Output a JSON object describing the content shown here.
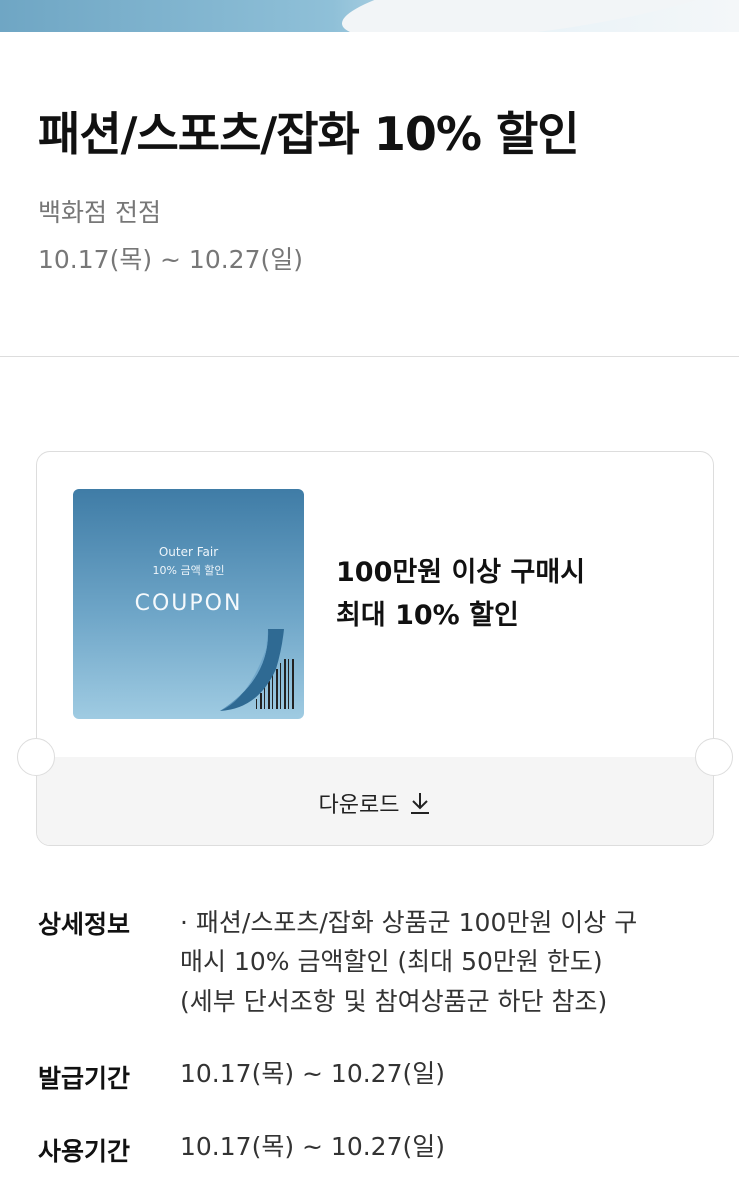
{
  "event": {
    "title": "패션/스포츠/잡화 10% 할인",
    "location": "백화점 전점",
    "period": "10.17(목) ~ 10.27(일)"
  },
  "coupon": {
    "image_text_1": "Outer Fair",
    "image_text_2": "10% 금액 할인",
    "image_text_3": "COUPON",
    "offer_line_1": "100만원 이상 구매시",
    "offer_line_2": "최대 10% 할인",
    "download_label": "다운로드",
    "download_icon": "download-arrow-icon"
  },
  "details": {
    "info_label": "상세정보",
    "info_line_1": "· 패션/스포츠/잡화 상품군 100만원 이상 구",
    "info_line_2": "매시 10% 금액할인 (최대 50만원 한도)",
    "info_line_3": "(세부 단서조항 및 참여상품군 하단 참조)",
    "issue_label": "발급기간",
    "issue_period": "10.17(목) ~ 10.27(일)",
    "use_label": "사용기간",
    "use_period": "10.17(목) ~ 10.27(일)"
  },
  "colors": {
    "coupon_blue": "#3f7ca6",
    "text_primary": "#111111",
    "text_secondary": "#777777"
  }
}
